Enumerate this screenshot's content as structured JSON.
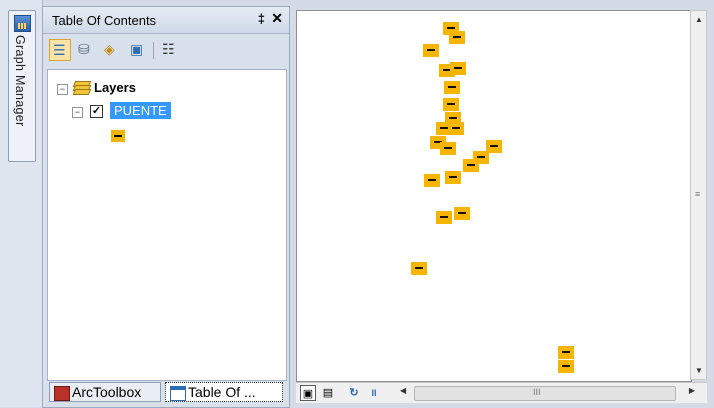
{
  "graph_manager": {
    "label": "Graph Manager",
    "icon": "graph-manager-icon"
  },
  "toc": {
    "title": "Table Of Contents",
    "pin_glyph": "‡",
    "close_glyph": "✕",
    "toolbar": [
      {
        "name": "list-by-drawing-order-icon",
        "glyph": "☰"
      },
      {
        "name": "list-by-source-icon",
        "glyph": "⛁"
      },
      {
        "name": "list-by-visibility-icon",
        "glyph": "◈"
      },
      {
        "name": "list-by-selection-icon",
        "glyph": "▣"
      },
      {
        "name": "options-icon",
        "glyph": "☷"
      }
    ],
    "tree": {
      "root_label": "Layers",
      "layer_label": "PUENTE",
      "layer_checked": true,
      "expander_glyph": "−"
    },
    "tabs": [
      {
        "label": "ArcToolbox",
        "icon": "arctoolbox-icon",
        "active": false
      },
      {
        "label": "Table Of ...",
        "icon": "table-of-contents-icon",
        "active": true
      }
    ]
  },
  "colors": {
    "feature_fill": "#f7b500",
    "selected_layer_bg": "#3399ff",
    "selected_layer_text": "#ffffff"
  },
  "bottom_bar": {
    "data_view_glyph": "▣",
    "layout_view_glyph": "▤",
    "refresh_glyph": "↻",
    "pause_glyph": "II",
    "scroll_grip": "III",
    "vscroll_grip": "≡"
  }
}
